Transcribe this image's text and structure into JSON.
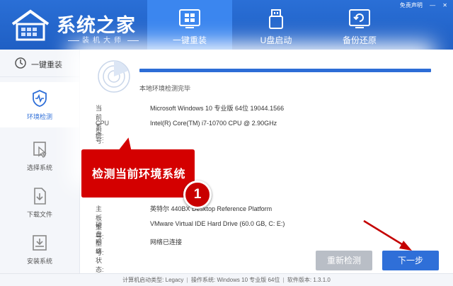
{
  "app": {
    "brand_title": "系统之家",
    "brand_subtitle": "装机大师",
    "window_controls": [
      "免责声明",
      "—",
      "✕"
    ]
  },
  "tabs": [
    {
      "label": "一键重装",
      "icon": "windows-icon",
      "active": true
    },
    {
      "label": "U盘启动",
      "icon": "usb-drive-icon",
      "active": false
    },
    {
      "label": "备份还原",
      "icon": "backup-restore-icon",
      "active": false
    }
  ],
  "sidebar": {
    "header": {
      "label": "一键重装",
      "icon": "reinstall-icon"
    },
    "items": [
      {
        "label": "环境检测",
        "icon": "shield-heartbeat-icon",
        "active": true
      },
      {
        "label": "选择系统",
        "icon": "select-cursor-icon",
        "active": false
      },
      {
        "label": "下载文件",
        "icon": "download-file-icon",
        "active": false
      },
      {
        "label": "安装系统",
        "icon": "install-tray-icon",
        "active": false
      }
    ]
  },
  "detection": {
    "progress_percent": 100,
    "status_text": "本地环境检测完毕",
    "rows": [
      {
        "key": "当前系统:",
        "value": "Microsoft Windows 10 专业版 64位 19044.1566"
      },
      {
        "key": "CPU型号:",
        "value": "Intel(R) Core(TM) i7-10700 CPU @ 2.90GHz"
      },
      {
        "key": "主板型号:",
        "value": "英特尔 440BX Desktop Reference Platform"
      },
      {
        "key": "硬盘型号:",
        "value": "VMware Virtual IDE Hard Drive (60.0 GB, C: E:)"
      },
      {
        "key": "网络状态:",
        "value": "网络已连接"
      }
    ]
  },
  "annotation": {
    "callout_text": "检测当前环境系统",
    "step_number": "1",
    "color": "#d40000"
  },
  "buttons": {
    "recheck": "重新检测",
    "next": "下一步"
  },
  "footer": {
    "boot_type_label": "计算机启动类型:",
    "boot_type_value": "Legacy",
    "os_label": "操作系统:",
    "os_value": "Windows 10 专业版 64位",
    "version_label": "软件版本:",
    "version_value": "1.3.1.0"
  }
}
